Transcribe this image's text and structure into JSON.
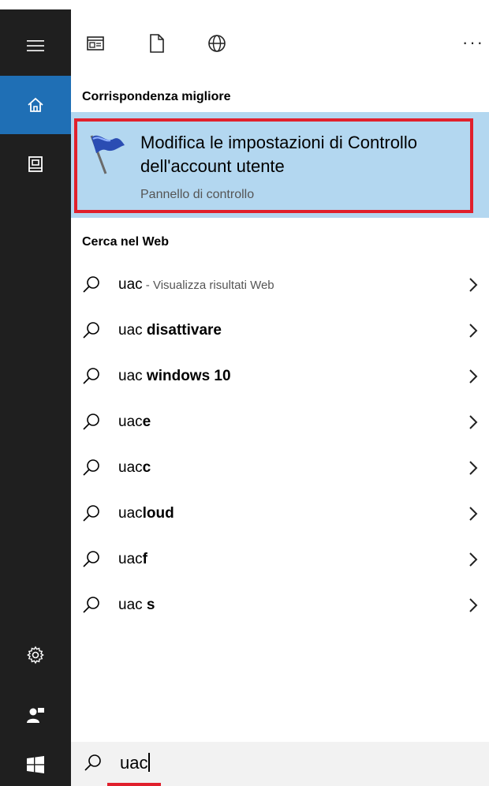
{
  "toolbar": {
    "icons": [
      "apps-icon",
      "document-icon",
      "globe-icon"
    ],
    "more_label": "···"
  },
  "sections": {
    "best_match": "Corrispondenza migliore",
    "web": "Cerca nel Web"
  },
  "best_match": {
    "title": "Modifica le impostazioni di Controllo dell'account utente",
    "subtitle": "Pannello di controllo",
    "icon": "uac-flag-icon"
  },
  "results": [
    {
      "prefix": "uac",
      "bold": "",
      "hint": " - Visualizza risultati Web"
    },
    {
      "prefix": "uac ",
      "bold": "disattivare",
      "hint": ""
    },
    {
      "prefix": "uac ",
      "bold": "windows 10",
      "hint": ""
    },
    {
      "prefix": "uac",
      "bold": "e",
      "hint": ""
    },
    {
      "prefix": "uac",
      "bold": "c",
      "hint": ""
    },
    {
      "prefix": "uac",
      "bold": "loud",
      "hint": ""
    },
    {
      "prefix": "uac",
      "bold": "f",
      "hint": ""
    },
    {
      "prefix": "uac ",
      "bold": "s",
      "hint": ""
    }
  ],
  "search": {
    "query": "uac"
  },
  "colors": {
    "rail": "#1f1f1f",
    "rail_active": "#1f6fb5",
    "highlight": "#b3d7f0",
    "annotation_red": "#e0202c"
  }
}
